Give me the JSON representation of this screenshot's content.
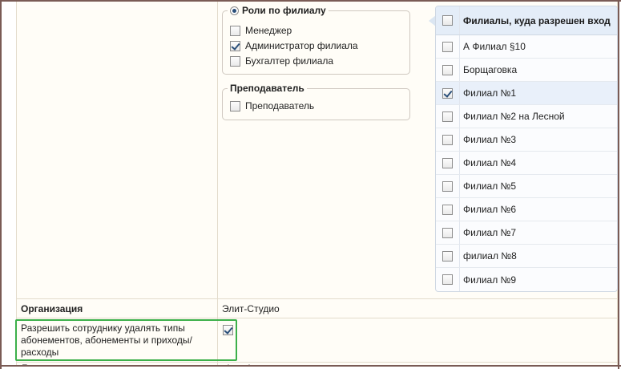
{
  "branch_roles": {
    "legend": "Роли по филиалу",
    "items": [
      {
        "label": "Менеджер",
        "checked": false
      },
      {
        "label": "Администратор филиала",
        "checked": true
      },
      {
        "label": "Бухгалтер филиала",
        "checked": false
      }
    ]
  },
  "teacher_group": {
    "legend": "Преподаватель",
    "items": [
      {
        "label": "Преподаватель",
        "checked": false
      }
    ]
  },
  "branches_table": {
    "header": "Филиалы, куда разрешен вход",
    "rows": [
      {
        "label": "А Филиал §10",
        "checked": false
      },
      {
        "label": "Борщаговка",
        "checked": false
      },
      {
        "label": "Филиал №1",
        "checked": true
      },
      {
        "label": "Филиал №2 на Лесной",
        "checked": false
      },
      {
        "label": "Филиал №3",
        "checked": false
      },
      {
        "label": "Филиал №4",
        "checked": false
      },
      {
        "label": "Филиал №5",
        "checked": false
      },
      {
        "label": "Филиал №6",
        "checked": false
      },
      {
        "label": "Филиал №7",
        "checked": false
      },
      {
        "label": "филиал №8",
        "checked": false
      },
      {
        "label": "Филиал №9",
        "checked": false
      }
    ]
  },
  "organization": {
    "label": "Организация",
    "value": "Элит-Студио"
  },
  "allow_delete": {
    "label": "Разрешить сотруднику удалять типы абонементов, абонементы и приходы/расходы",
    "checked": true
  },
  "login_row": {
    "label": "Логин",
    "value": "elemeha"
  },
  "colors": {
    "frame": "#7a5b55",
    "highlight": "#3cb04a",
    "table_header_bg": "#e4edf8",
    "check_mark": "#2a4f7a"
  }
}
